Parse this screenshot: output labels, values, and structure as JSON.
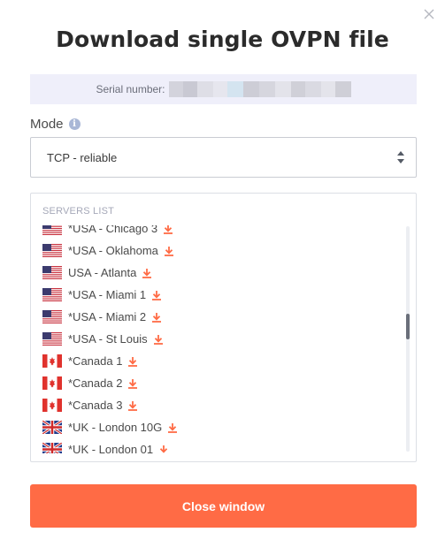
{
  "dialog": {
    "title": "Download single OVPN file",
    "close_icon": "close-icon"
  },
  "serial": {
    "label": "Serial number:",
    "value_state": "blurred"
  },
  "mode": {
    "label": "Mode",
    "info_icon": "info-icon",
    "info_glyph": "i",
    "selected": "TCP - reliable"
  },
  "servers": {
    "heading": "SERVERS LIST",
    "items": [
      {
        "label": "*USA - Chicago 3",
        "flag": "us"
      },
      {
        "label": "*USA - Oklahoma",
        "flag": "us"
      },
      {
        "label": "USA - Atlanta",
        "flag": "us"
      },
      {
        "label": "*USA - Miami 1",
        "flag": "us"
      },
      {
        "label": "*USA - Miami 2",
        "flag": "us"
      },
      {
        "label": "*USA - St Louis",
        "flag": "us"
      },
      {
        "label": "*Canada 1",
        "flag": "ca"
      },
      {
        "label": "*Canada 2",
        "flag": "ca"
      },
      {
        "label": "*Canada 3",
        "flag": "ca"
      },
      {
        "label": "*UK - London 10G",
        "flag": "uk"
      },
      {
        "label": "*UK - London 01",
        "flag": "uk"
      }
    ]
  },
  "footer": {
    "close_label": "Close window"
  },
  "colors": {
    "accent": "#ff6b45",
    "serial_bg": "#efeffa"
  }
}
